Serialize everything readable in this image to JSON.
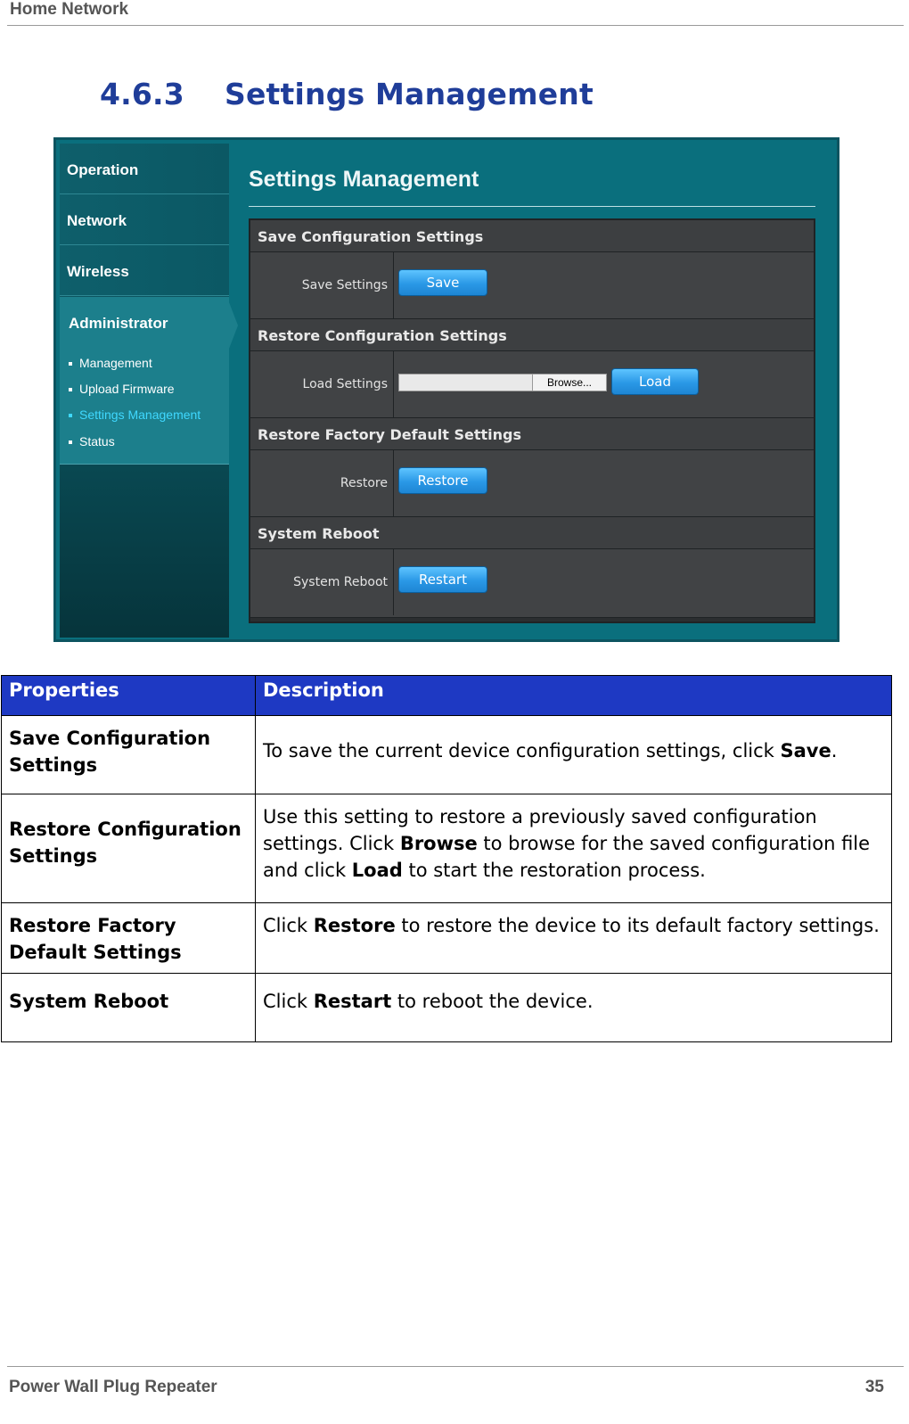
{
  "header": {
    "title": "Home Network"
  },
  "section": {
    "number": "4.6.3",
    "title": "Settings Management"
  },
  "screenshot": {
    "sidebar": {
      "items": [
        "Operation",
        "Network",
        "Wireless"
      ],
      "admin": {
        "title": "Administrator",
        "subitems": [
          "Management",
          "Upload Firmware",
          "Settings Management",
          "Status"
        ],
        "active": "Settings Management"
      }
    },
    "page_title": "Settings Management",
    "sections": [
      {
        "header": "Save Configuration Settings",
        "label": "Save Settings",
        "button": "Save"
      },
      {
        "header": "Restore Configuration Settings",
        "label": "Load Settings",
        "browse": "Browse...",
        "button": "Load"
      },
      {
        "header": "Restore Factory Default Settings",
        "label": "Restore",
        "button": "Restore"
      },
      {
        "header": "System Reboot",
        "label": "System Reboot",
        "button": "Restart"
      }
    ],
    "colors": {
      "panel_bg": "#0a6f7d",
      "button": "#2a98e6",
      "active_link": "#3fd8ff"
    }
  },
  "table": {
    "headers": [
      "Properties",
      "Description"
    ],
    "rows": [
      {
        "property": "Save Configuration Settings",
        "pre": "To save the current device configuration settings, click ",
        "b1": "Save",
        "mid": ".",
        "b2": "",
        "post": ""
      },
      {
        "property": "Restore Configuration Settings",
        "pre": "Use this setting to restore a previously saved configuration settings. Click ",
        "b1": "Browse",
        "mid": " to browse for the saved configuration file and click ",
        "b2": "Load",
        "post": " to start the restoration process."
      },
      {
        "property": "Restore Factory Default Settings",
        "pre": "Click ",
        "b1": "Restore",
        "mid": " to restore the device to its default factory settings.",
        "b2": "",
        "post": ""
      },
      {
        "property": "System Reboot",
        "pre": "Click ",
        "b1": "Restart",
        "mid": " to reboot the device.",
        "b2": "",
        "post": ""
      }
    ],
    "header_color": "#1e39c3"
  },
  "footer": {
    "left": "Power Wall Plug Repeater",
    "page": "35"
  }
}
